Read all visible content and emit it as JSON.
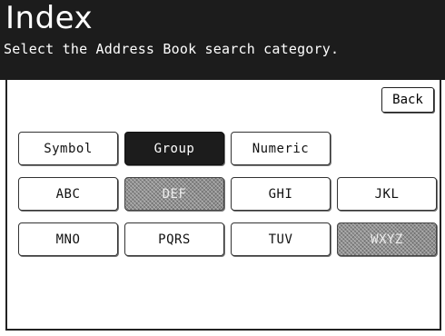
{
  "header": {
    "title": "Index",
    "subtitle": "Select the Address Book search category."
  },
  "back_label": "Back",
  "categories": [
    {
      "label": "Symbol",
      "state": "normal"
    },
    {
      "label": "Group",
      "state": "selected"
    },
    {
      "label": "Numeric",
      "state": "normal"
    },
    {
      "label": "ABC",
      "state": "normal"
    },
    {
      "label": "DEF",
      "state": "disabled"
    },
    {
      "label": "GHI",
      "state": "normal"
    },
    {
      "label": "JKL",
      "state": "normal"
    },
    {
      "label": "MNO",
      "state": "normal"
    },
    {
      "label": "PQRS",
      "state": "normal"
    },
    {
      "label": "TUV",
      "state": "normal"
    },
    {
      "label": "WXYZ",
      "state": "disabled"
    }
  ]
}
